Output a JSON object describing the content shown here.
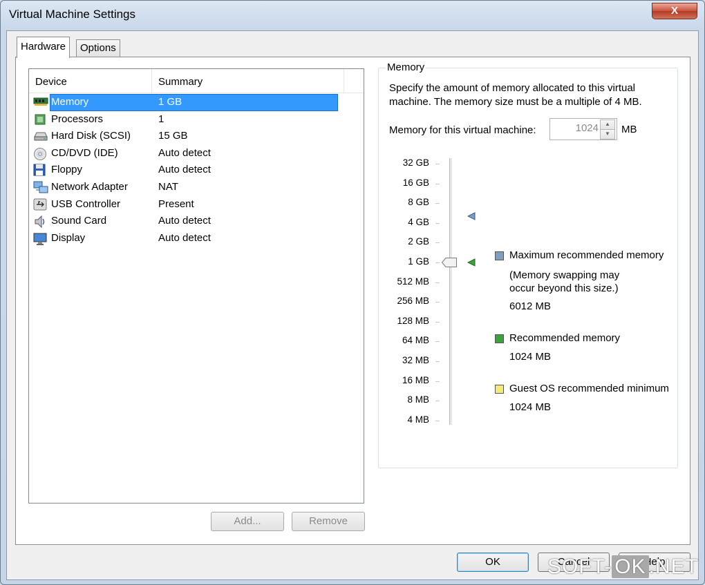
{
  "window": {
    "title": "Virtual Machine Settings",
    "close_label": "X"
  },
  "tabs": [
    {
      "label": "Hardware"
    },
    {
      "label": "Options"
    }
  ],
  "device_list": {
    "columns": {
      "device": "Device",
      "summary": "Summary"
    },
    "rows": [
      {
        "device": "Memory",
        "summary": "1 GB",
        "icon": "memory-icon"
      },
      {
        "device": "Processors",
        "summary": "1",
        "icon": "processor-icon"
      },
      {
        "device": "Hard Disk (SCSI)",
        "summary": "15 GB",
        "icon": "hard-disk-icon"
      },
      {
        "device": "CD/DVD (IDE)",
        "summary": "Auto detect",
        "icon": "cd-dvd-icon"
      },
      {
        "device": "Floppy",
        "summary": "Auto detect",
        "icon": "floppy-icon"
      },
      {
        "device": "Network Adapter",
        "summary": "NAT",
        "icon": "network-adapter-icon"
      },
      {
        "device": "USB Controller",
        "summary": "Present",
        "icon": "usb-icon"
      },
      {
        "device": "Sound Card",
        "summary": "Auto detect",
        "icon": "sound-card-icon"
      },
      {
        "device": "Display",
        "summary": "Auto detect",
        "icon": "display-icon"
      }
    ],
    "selected_index": 0
  },
  "list_buttons": {
    "add": "Add...",
    "remove": "Remove"
  },
  "memory": {
    "group_label": "Memory",
    "description": "Specify the amount of memory allocated to this virtual machine. The memory size must be a multiple of 4 MB.",
    "field_label": "Memory for this virtual machine:",
    "value": "1024",
    "unit": "MB",
    "scale": [
      "32 GB",
      "16 GB",
      "8 GB",
      "4 GB",
      "2 GB",
      "1 GB",
      "512 MB",
      "256 MB",
      "128 MB",
      "64 MB",
      "32 MB",
      "16 MB",
      "8 MB",
      "4 MB"
    ],
    "current_scale_index": 5,
    "max_marker_index": 3,
    "rec_marker_index": 5,
    "legend": {
      "max_label": "Maximum recommended memory",
      "max_note": "(Memory swapping may occur beyond this size.)",
      "max_value": "6012 MB",
      "rec_label": "Recommended memory",
      "rec_value": "1024 MB",
      "guest_label": "Guest OS recommended minimum",
      "guest_value": "1024 MB"
    },
    "colors": {
      "max": "#7f9ec0",
      "rec": "#3aa33a",
      "guest": "#f5e97a"
    }
  },
  "footer": {
    "ok": "OK",
    "cancel": "Cancel",
    "help": "Help"
  },
  "watermark": {
    "left": "SOFT-",
    "box": "OK",
    "right": ".NET"
  }
}
